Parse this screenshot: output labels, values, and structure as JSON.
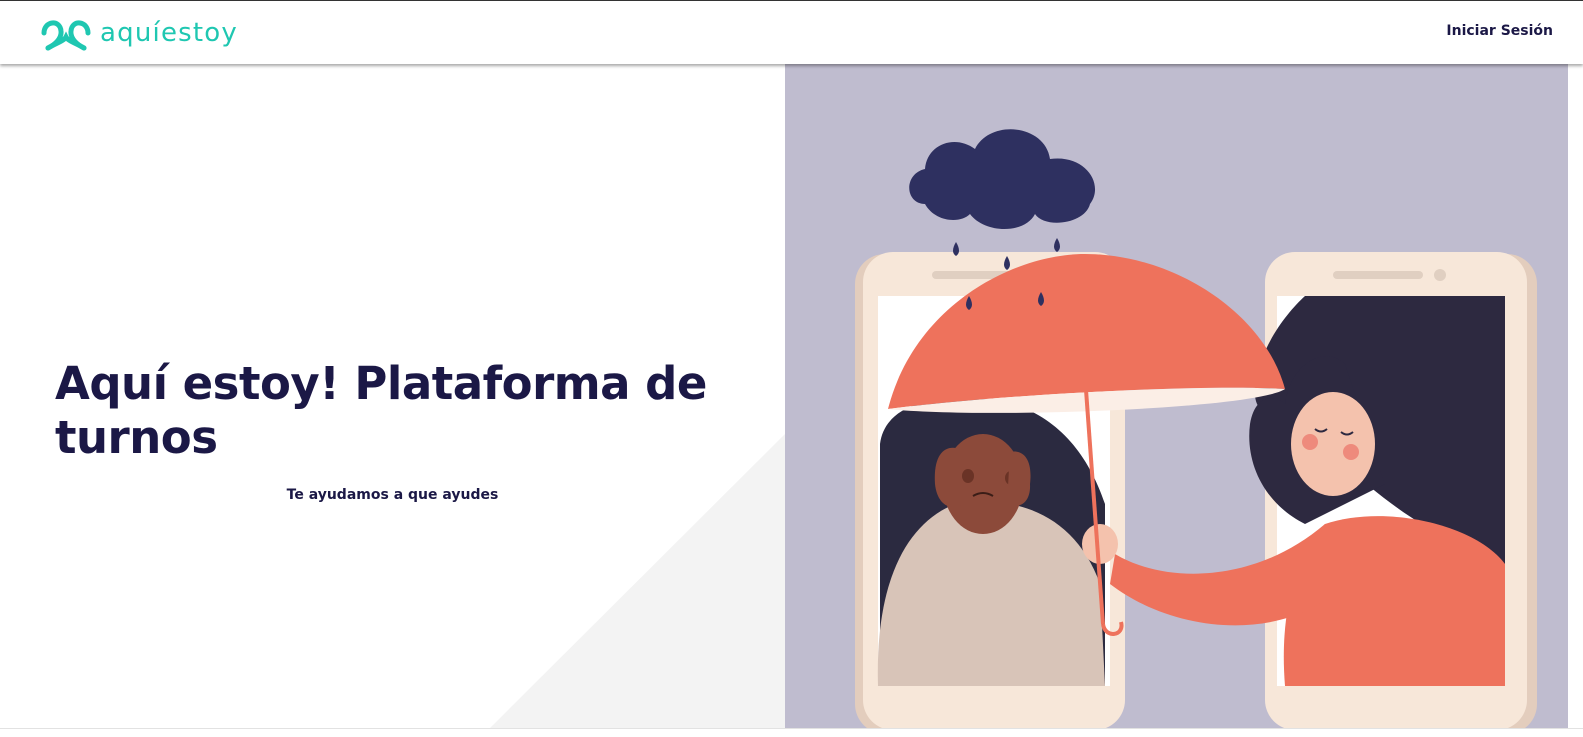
{
  "header": {
    "brand_name": "aquíestoy",
    "brand_icon": "linked-loops-logo",
    "login_label": "Iniciar Sesión"
  },
  "hero": {
    "title": "Aquí estoy! Plataforma de turnos",
    "subtitle": "Te ayudamos a que ayudes",
    "illustration": "umbrella-support-phones-illustration"
  },
  "colors": {
    "brand_teal": "#1fc7b1",
    "text_navy": "#1b1846",
    "illustration_bg": "#bfbccf",
    "umbrella_coral": "#ee725c",
    "cloud_navy": "#2e3060"
  }
}
